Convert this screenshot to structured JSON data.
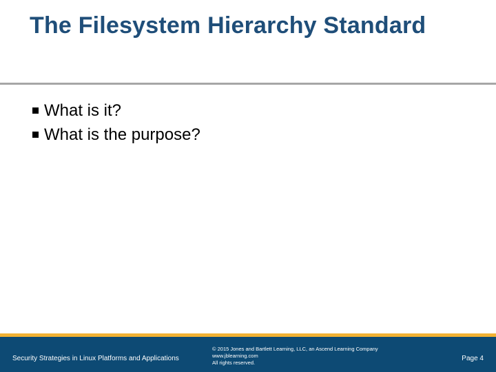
{
  "title": "The Filesystem Hierarchy Standard",
  "bullets": {
    "items": [
      {
        "text": "What is it?"
      },
      {
        "text": "What is the purpose?"
      }
    ]
  },
  "footer": {
    "course": "Security Strategies in Linux Platforms and Applications",
    "legal_line1": "© 2015 Jones and Bartlett Learning, LLC, an Ascend Learning Company",
    "legal_line2": "www.jblearning.com",
    "legal_line3": "All rights reserved.",
    "page_label": "Page 4"
  }
}
